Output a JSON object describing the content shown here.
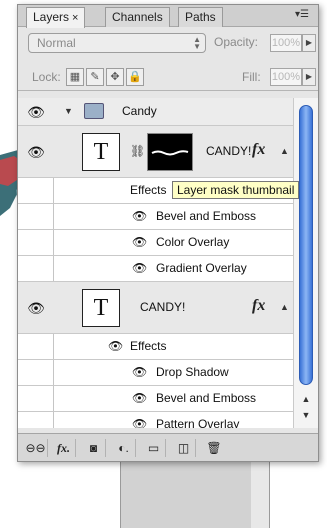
{
  "tabs": [
    {
      "label": "Layers",
      "close": "×",
      "active": true
    },
    {
      "label": "Channels",
      "active": false
    },
    {
      "label": "Paths",
      "active": false
    }
  ],
  "panel_menu_icon": "panel-menu-icon",
  "blend_mode": {
    "value": "Normal"
  },
  "opacity": {
    "label": "Opacity:",
    "value": "100%"
  },
  "lock": {
    "label": "Lock:",
    "icons": [
      "lock-transparent-icon",
      "lock-image-icon",
      "lock-position-icon",
      "lock-all-icon"
    ]
  },
  "fill": {
    "label": "Fill:",
    "value": "100%"
  },
  "layers": {
    "group": {
      "name": "Candy",
      "icon": "folder-icon"
    },
    "layer1": {
      "name": "CANDY!",
      "fx": "fx",
      "effects_label": "Effects",
      "effects": [
        "Bevel and Emboss",
        "Color Overlay",
        "Gradient Overlay"
      ]
    },
    "layer2": {
      "name": "CANDY!",
      "fx": "fx",
      "effects_label": "Effects",
      "effects": [
        "Drop Shadow",
        "Bevel and Emboss",
        "Pattern Overlay"
      ]
    }
  },
  "tooltip": "Layer mask thumbnail",
  "colors": {
    "scroll_thumb": "#3a72d6",
    "tooltip_bg": "#ffffc6",
    "panel_bg": "#e6e6e6"
  },
  "bottom_bar_icons": [
    "link-layers-icon",
    "layer-style-icon",
    "layer-mask-icon",
    "adjustment-layer-icon",
    "new-group-icon",
    "new-layer-icon",
    "delete-layer-icon"
  ]
}
